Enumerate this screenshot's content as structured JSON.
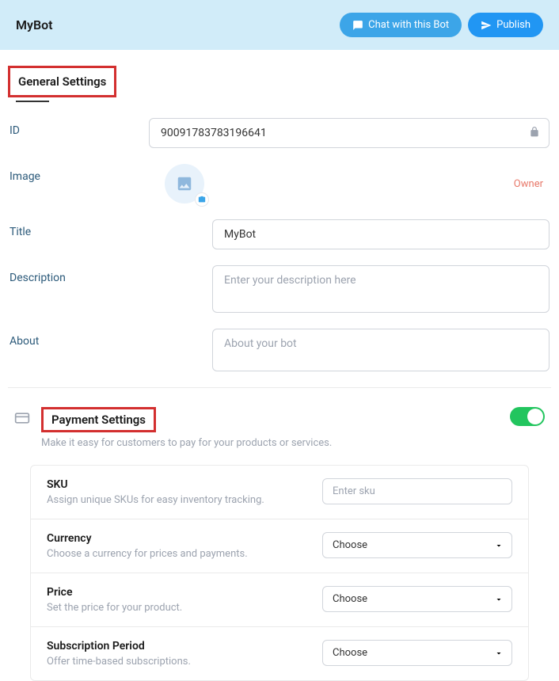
{
  "header": {
    "title": "MyBot",
    "chat_label": "Chat with this Bot",
    "publish_label": "Publish"
  },
  "general": {
    "section_title": "General Settings",
    "id_label": "ID",
    "id_value": "90091783783196641",
    "image_label": "Image",
    "owner_label": "Owner",
    "title_label": "Title",
    "title_value": "MyBot",
    "description_label": "Description",
    "description_placeholder": "Enter your description here",
    "about_label": "About",
    "about_placeholder": "About your bot"
  },
  "payment": {
    "section_title": "Payment Settings",
    "section_sub": "Make it easy for customers to pay for your products or services.",
    "sku_title": "SKU",
    "sku_sub": "Assign unique SKUs for easy inventory tracking.",
    "sku_placeholder": "Enter sku",
    "currency_title": "Currency",
    "currency_sub": "Choose a currency for prices and payments.",
    "price_title": "Price",
    "price_sub": "Set the price for your product.",
    "subscription_title": "Subscription Period",
    "subscription_sub": "Offer time-based subscriptions.",
    "choose_label": "Choose"
  }
}
